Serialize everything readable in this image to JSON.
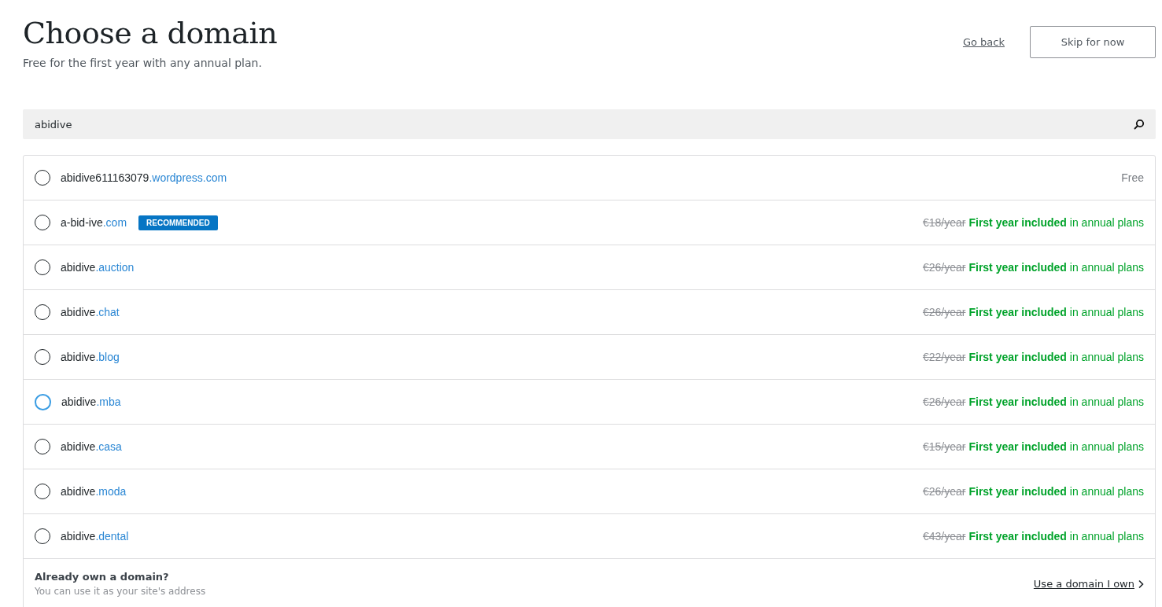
{
  "header": {
    "title": "Choose a domain",
    "subtitle": "Free for the first year with any annual plan.",
    "back_link": "Go back",
    "skip_button": "Skip for now"
  },
  "search": {
    "value": "abidive"
  },
  "domains": [
    {
      "name": "abidive611163079",
      "tld": ".wordpress.com",
      "kind": "free",
      "price": "Free",
      "focus_ring": false
    },
    {
      "name": "a-bid-ive",
      "tld": ".com",
      "badge": "RECOMMENDED",
      "kind": "sale",
      "old_price": "€18/year",
      "offer": "**First year included** in annual plans",
      "focus_ring": false
    },
    {
      "name": "abidive",
      "tld": ".auction",
      "kind": "sale",
      "old_price": "€26/year",
      "offer": "**First year included** in annual plans",
      "focus_ring": false
    },
    {
      "name": "abidive",
      "tld": ".chat",
      "kind": "sale",
      "old_price": "€26/year",
      "offer": "**First year included** in annual plans",
      "focus_ring": false
    },
    {
      "name": "abidive",
      "tld": ".blog",
      "kind": "sale",
      "old_price": "€22/year",
      "offer": "**First year included** in annual plans",
      "focus_ring": false
    },
    {
      "name": "abidive",
      "tld": ".mba",
      "kind": "sale",
      "old_price": "€26/year",
      "offer": "**First year included** in annual plans",
      "focus_ring": true
    },
    {
      "name": "abidive",
      "tld": ".casa",
      "kind": "sale",
      "old_price": "€15/year",
      "offer": "**First year included** in annual plans",
      "focus_ring": false
    },
    {
      "name": "abidive",
      "tld": ".moda",
      "kind": "sale",
      "old_price": "€26/year",
      "offer": "**First year included** in annual plans",
      "focus_ring": false
    },
    {
      "name": "abidive",
      "tld": ".dental",
      "kind": "sale",
      "old_price": "€43/year",
      "offer": "**First year included** in annual plans",
      "focus_ring": false
    }
  ],
  "own_domain": {
    "title": "Already own a domain?",
    "text": "You can use it as your site's address",
    "link": "Use a domain I own"
  }
}
